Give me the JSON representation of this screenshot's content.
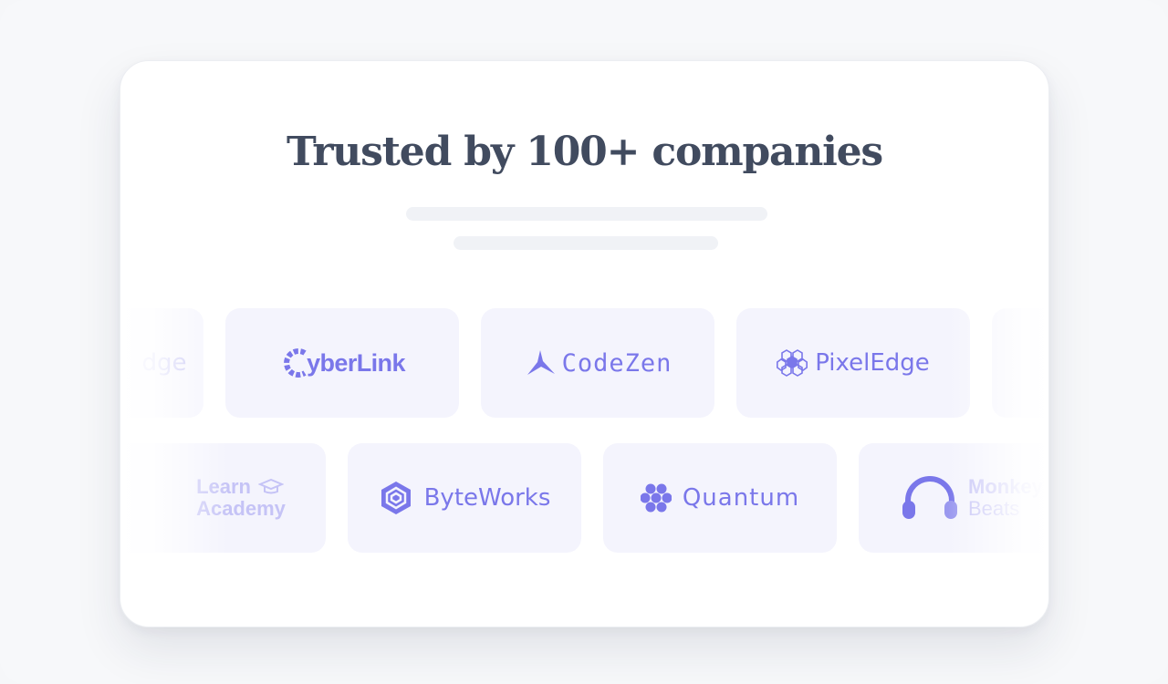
{
  "section": {
    "title": "Trusted by 100+ companies"
  },
  "logos_row1": [
    {
      "name": "PixelEdge",
      "partial": "dge"
    },
    {
      "name": "CyberLink",
      "display_prefix": "C",
      "display_rest": "yberLink"
    },
    {
      "name": "CodeZen"
    },
    {
      "name": "PixelEdge"
    }
  ],
  "logos_row2": [
    {
      "line1": "Learn",
      "line2": "Academy"
    },
    {
      "name": "ByteWorks"
    },
    {
      "name": "Quantum"
    },
    {
      "line1": "Monkey",
      "line2": "Beats"
    }
  ],
  "colors": {
    "accent": "#7a77ea",
    "tile_bg": "#f4f4fd",
    "title": "#414b5f"
  }
}
